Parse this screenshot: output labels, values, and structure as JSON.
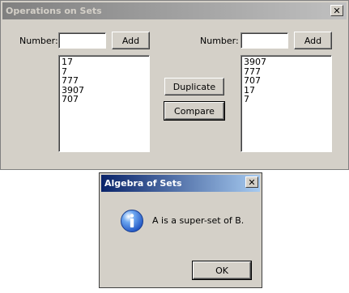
{
  "main_window": {
    "title": "Operations on Sets",
    "left": {
      "number_label": "Number:",
      "number_value": "",
      "add_label": "Add",
      "items": [
        "17",
        "7",
        "777",
        "3907",
        "707"
      ]
    },
    "right": {
      "number_label": "Number:",
      "number_value": "",
      "add_label": "Add",
      "items": [
        "3907",
        "777",
        "707",
        "17",
        "7"
      ]
    },
    "duplicate_label": "Duplicate",
    "compare_label": "Compare"
  },
  "dialog": {
    "title": "Algebra of Sets",
    "message": "A is a super-set of B.",
    "ok_label": "OK",
    "icon": "info-icon"
  }
}
